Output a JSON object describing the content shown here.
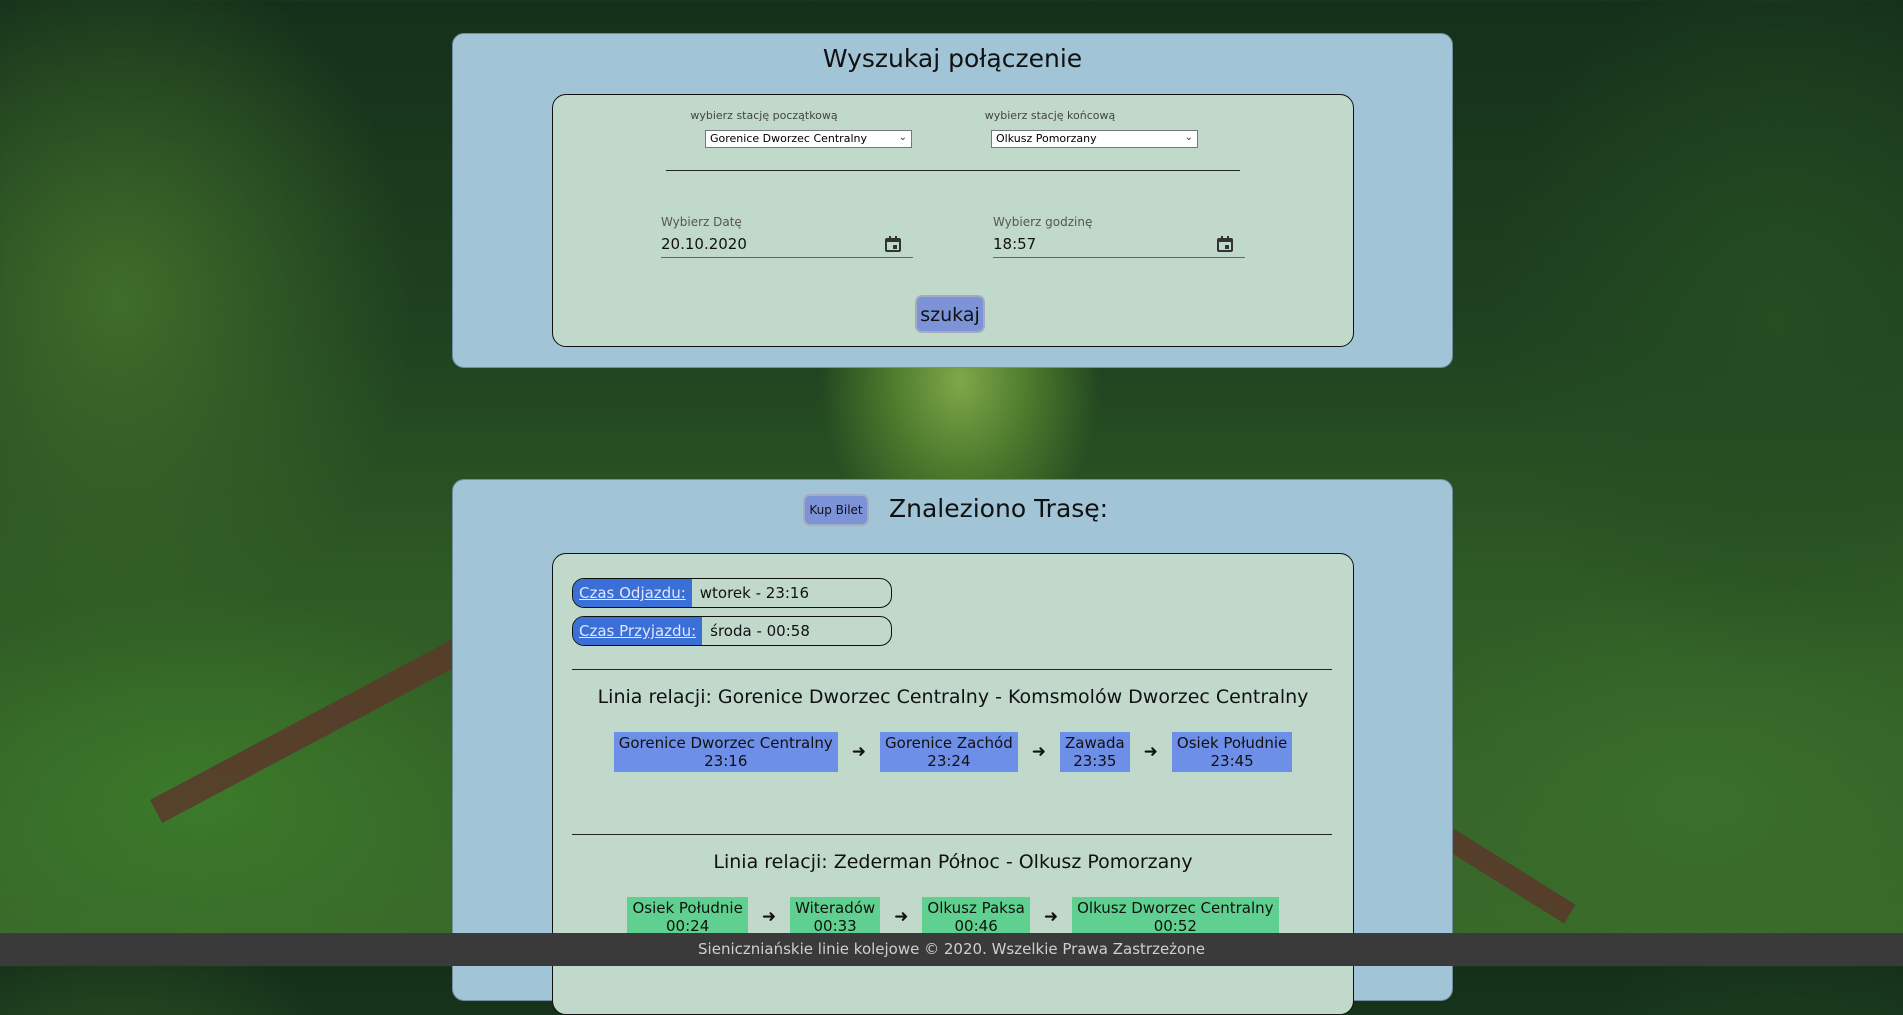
{
  "search": {
    "title": "Wyszukaj połączenie",
    "start_label": "wybierz stację początkową",
    "start_value": "Gorenice Dworzec Centralny",
    "end_label": "wybierz stację końcową",
    "end_value": "Olkusz Pomorzany",
    "date_label": "Wybierz Datę",
    "date_value": "20.10.2020",
    "time_label": "Wybierz godzinę",
    "time_value": "18:57",
    "submit_label": "szukaj"
  },
  "result": {
    "buy_label": "Kup Bilet",
    "title": "Znaleziono Trasę:",
    "departure_tag": "Czas Odjazdu:",
    "departure_value": "wtorek - 23:16",
    "arrival_tag": "Czas Przyjazdu:",
    "arrival_value": "środa - 00:58",
    "lines": [
      {
        "title": "Linia relacji: Gorenice Dworzec Centralny - Komsmolów Dworzec Centralny",
        "stops": [
          {
            "name": "Gorenice Dworzec Centralny",
            "time": "23:16"
          },
          {
            "name": "Gorenice Zachód",
            "time": "23:24"
          },
          {
            "name": "Zawada",
            "time": "23:35"
          },
          {
            "name": "Osiek Południe",
            "time": "23:45"
          }
        ]
      },
      {
        "title": "Linia relacji: Zederman Północ - Olkusz Pomorzany",
        "stops": [
          {
            "name": "Osiek Południe",
            "time": "00:24"
          },
          {
            "name": "Witeradów",
            "time": "00:33"
          },
          {
            "name": "Olkusz Paksa",
            "time": "00:46"
          },
          {
            "name": "Olkusz Dworzec Centralny",
            "time": "00:52"
          }
        ]
      }
    ]
  },
  "footer": "Sieniczniańskie linie kolejowe © 2020. Wszelkie Prawa Zastrzeżone",
  "colors": {
    "panel": "#a1c4d6",
    "inner": "#c1d9cb",
    "button": "#7d93d8",
    "tag": "#3b6fd8",
    "stop_line1": "#6d8fe8",
    "stop_line2": "#5fd08f",
    "footer": "#3a3a3a"
  },
  "icons": [
    "calendar-icon",
    "arrow-right-icon",
    "chevron-down-icon"
  ]
}
